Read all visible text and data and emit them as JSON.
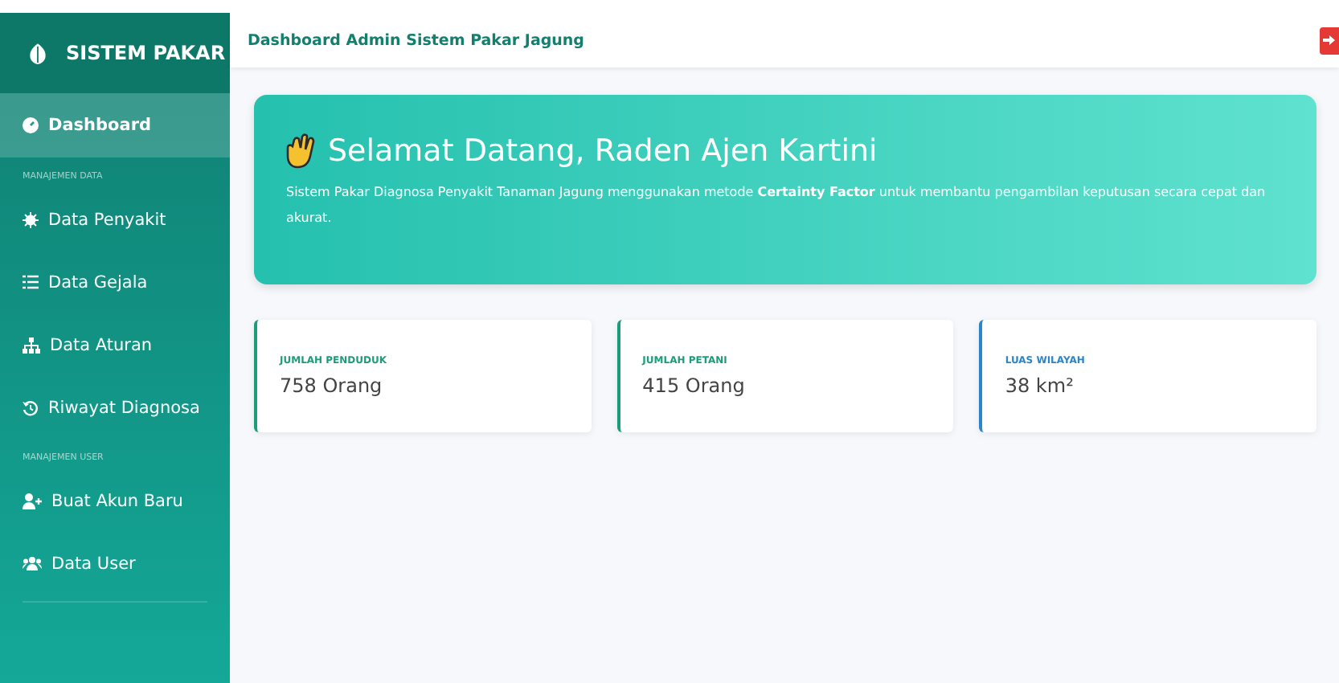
{
  "sidebar": {
    "brand": "SISTEM PAKAR",
    "items": [
      {
        "kind": "link",
        "label": "Dashboard",
        "selected": true
      },
      {
        "kind": "section",
        "label": "MANAJEMEN DATA"
      },
      {
        "kind": "link",
        "label": "Data Penyakit",
        "selected": false
      },
      {
        "kind": "link",
        "label": "Data Gejala",
        "selected": false
      },
      {
        "kind": "link",
        "label": "Data Aturan",
        "selected": false
      },
      {
        "kind": "link",
        "label": "Riwayat Diagnosa",
        "selected": false
      },
      {
        "kind": "section",
        "label": "MANAJEMEN USER"
      },
      {
        "kind": "link",
        "label": "Buat Akun Baru",
        "selected": false
      },
      {
        "kind": "link",
        "label": "Data User",
        "selected": false
      }
    ]
  },
  "header": {
    "title": "Dashboard Admin Sistem Pakar Jagung"
  },
  "welcome": {
    "title": "Selamat Datang, Raden Ajen Kartini",
    "text": "Sistem Pakar Diagnosa Penyakit Tanaman Jagung menggunakan metode **Certainty Factor** untuk membantu pengambilan keputusan secara cepat dan akurat."
  },
  "stats": [
    {
      "label": "JUMLAH PENDUDUK",
      "value": "758 Orang",
      "color": "#1a9e7a"
    },
    {
      "label": "JUMLAH PETANI",
      "value": "415 Orang",
      "color": "#1a9e7a"
    },
    {
      "label": "LUAS WILAYAH",
      "value": "38 km²",
      "color": "#2a86c8"
    }
  ]
}
